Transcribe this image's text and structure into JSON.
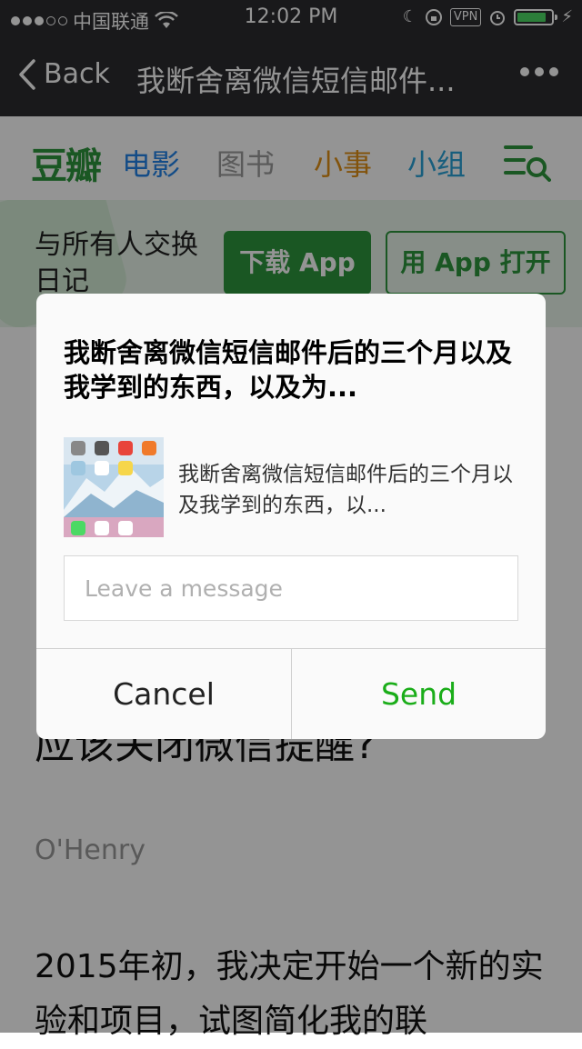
{
  "status_bar": {
    "carrier": "中国联通",
    "time": "12:02 PM",
    "vpn": "VPN",
    "signal_dots_filled": 3,
    "signal_dots_total": 5,
    "battery_level": 0.85
  },
  "nav": {
    "back_label": "Back",
    "title": "我断舍离微信短信邮件..."
  },
  "page": {
    "logo": "豆瓣",
    "nav_items": [
      "电影",
      "图书",
      "小事",
      "小组"
    ],
    "banner_text": "与所有人交换日记",
    "download_btn": "下载 App",
    "open_btn": "用 App 打开",
    "article_title": "应该关闭微信提醒?",
    "author": "O'Henry",
    "body_text": "2015年初，我决定开始一个新的实验和项目，试图简化我的联"
  },
  "dialog": {
    "title": "我断舍离微信短信邮件后的三个月以及我学到的东西，以及为...",
    "description": "我断舍离微信短信邮件后的三个月以及我学到的东西，以...",
    "message_placeholder": "Leave a message",
    "cancel_label": "Cancel",
    "send_label": "Send"
  },
  "colors": {
    "douban_green": "#2e963d",
    "send_green": "#1aad19",
    "navbar_bg": "#2c2c30"
  }
}
